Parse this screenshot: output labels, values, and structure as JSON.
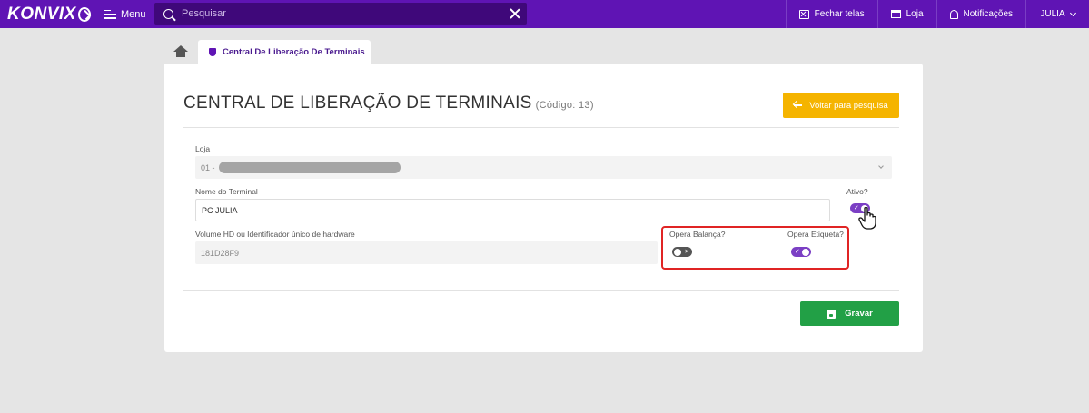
{
  "topbar": {
    "brand": "KONVIX",
    "menu_label": "Menu",
    "search_placeholder": "Pesquisar",
    "fechar_telas": "Fechar telas",
    "loja": "Loja",
    "notificacoes": "Notificações",
    "user": "JULIA",
    "color": "#5f14b4"
  },
  "tabs": [
    {
      "label": "Central De Liberação De Terminais",
      "icon": "shield-icon"
    }
  ],
  "page": {
    "title": "CENTRAL DE LIBERAÇÃO DE TERMINAIS",
    "code": "(Código: 13)",
    "back_label": "Voltar para pesquisa"
  },
  "form": {
    "loja_label": "Loja",
    "loja_value": "01 -",
    "nome_label": "Nome do Terminal",
    "nome_value": "PC JULIA",
    "ativo_label": "Ativo?",
    "ativo_value": true,
    "volume_label": "Volume HD ou Identificador único de hardware",
    "volume_value": "181D28F9",
    "balanca_label": "Opera Balança?",
    "balanca_value": false,
    "etiqueta_label": "Opera Etiqueta?",
    "etiqueta_value": true
  },
  "save_label": "Gravar",
  "colors": {
    "accent": "#5f14b4",
    "toggle_on": "#7b3fc4",
    "back_button": "#f5b400",
    "save_button": "#22a046",
    "highlight": "#e02424"
  }
}
